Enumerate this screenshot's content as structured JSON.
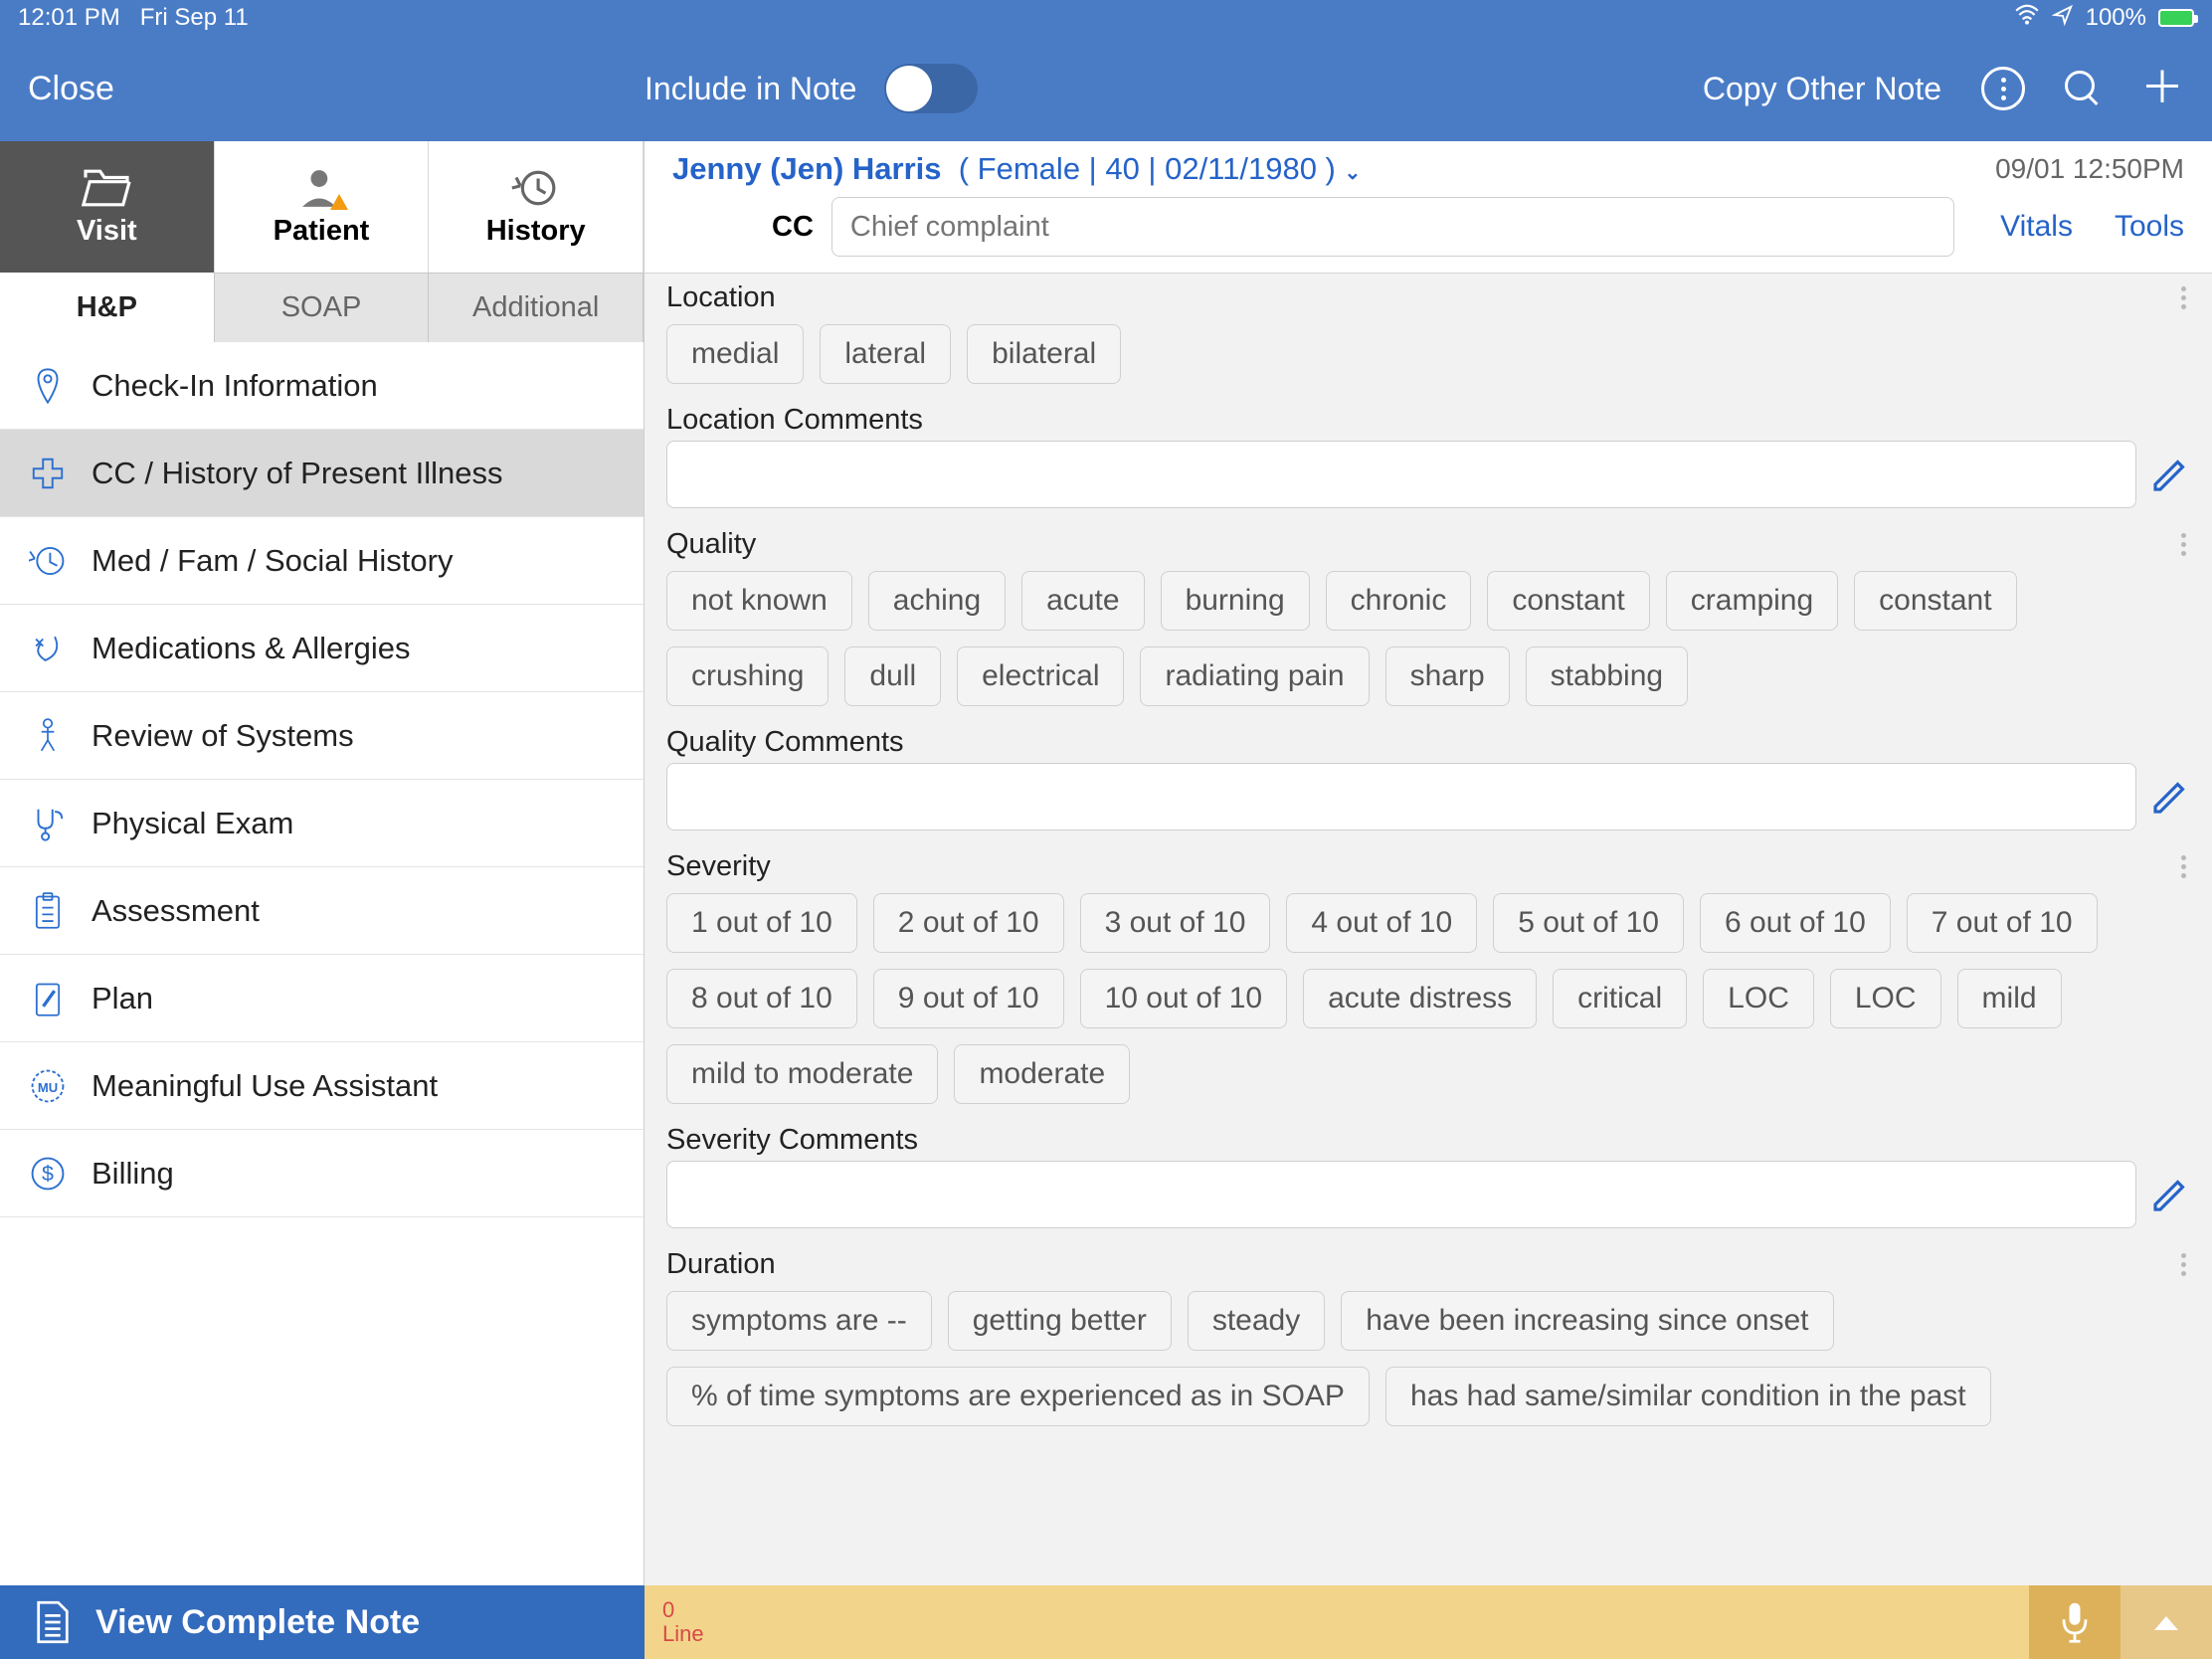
{
  "status": {
    "time": "12:01 PM",
    "date": "Fri Sep 11",
    "battery": "100%"
  },
  "nav": {
    "close": "Close",
    "include": "Include in Note",
    "copy": "Copy Other Note"
  },
  "tabs": {
    "visit": "Visit",
    "patient": "Patient",
    "history": "History"
  },
  "subtabs": {
    "hp": "H&P",
    "soap": "SOAP",
    "additional": "Additional"
  },
  "navlist": [
    "Check-In Information",
    "CC / History of Present Illness",
    "Med / Fam / Social History",
    "Medications & Allergies",
    "Review of Systems",
    "Physical Exam",
    "Assessment",
    "Plan",
    "Meaningful Use Assistant",
    "Billing"
  ],
  "patient": {
    "name": "Jenny (Jen) Harris",
    "meta": "( Female | 40 | 02/11/1980 )",
    "timestamp": "09/01 12:50PM",
    "cc_label": "CC",
    "cc_placeholder": "Chief complaint",
    "links": {
      "vitals": "Vitals",
      "tools": "Tools"
    }
  },
  "sections": {
    "location": {
      "title": "Location",
      "chips": [
        "medial",
        "lateral",
        "bilateral"
      ],
      "comments_title": "Location Comments"
    },
    "quality": {
      "title": "Quality",
      "chips": [
        "not known",
        "aching",
        "acute",
        "burning",
        "chronic",
        "constant",
        "cramping",
        "constant",
        "crushing",
        "dull",
        "electrical",
        "radiating pain",
        "sharp",
        "stabbing"
      ],
      "comments_title": "Quality Comments"
    },
    "severity": {
      "title": "Severity",
      "chips": [
        "1 out of 10",
        "2 out of 10",
        "3 out of 10",
        "4 out of 10",
        "5 out of 10",
        "6 out of 10",
        "7 out of 10",
        "8 out of 10",
        "9 out of 10",
        "10 out of 10",
        "acute distress",
        "critical",
        "LOC",
        "LOC",
        "mild",
        "mild to moderate",
        "moderate"
      ],
      "comments_title": "Severity Comments"
    },
    "duration": {
      "title": "Duration",
      "chips": [
        "symptoms are --",
        "getting better",
        "steady",
        "have been increasing since onset",
        "% of time symptoms are experienced as in SOAP",
        "has had same/similar condition in the past"
      ]
    }
  },
  "footer": {
    "note_btn": "View Complete Note",
    "line_count": "0",
    "line_label": "Line"
  }
}
